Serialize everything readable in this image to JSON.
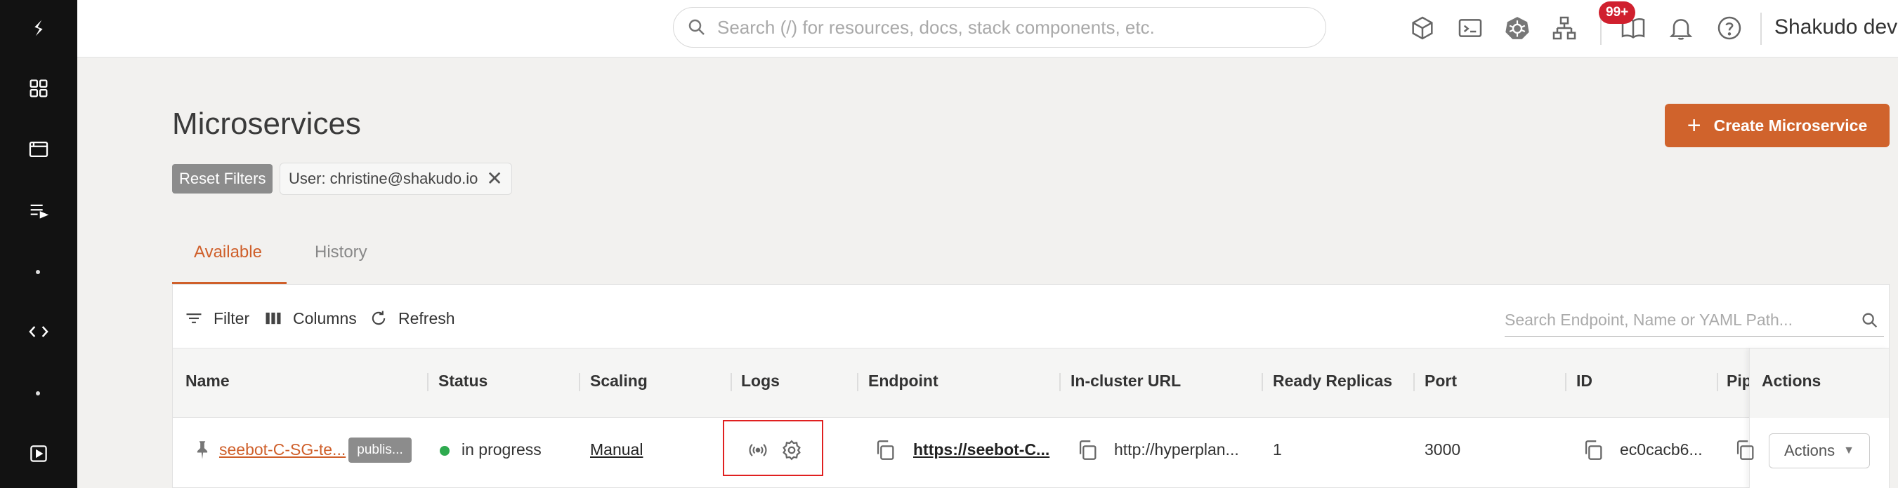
{
  "sidebar": {
    "items": [
      {
        "icon": "logo-icon"
      },
      {
        "icon": "grid-icon"
      },
      {
        "icon": "browser-window-icon"
      },
      {
        "icon": "playlist-icon"
      },
      {
        "icon": "dot-icon"
      },
      {
        "icon": "code-icon"
      },
      {
        "icon": "dot-icon"
      },
      {
        "icon": "play-box-icon"
      }
    ]
  },
  "header": {
    "search_placeholder": "Search (/) for resources, docs, stack components, etc.",
    "icons": [
      "cube-icon",
      "terminal-icon",
      "kubernetes-icon",
      "network-icon",
      "book-icon",
      "bell-icon",
      "help-icon"
    ],
    "notification_badge": "99+",
    "user_name": "Shakudo dev"
  },
  "page": {
    "title": "Microservices",
    "create_button": "Create Microservice",
    "create_button_icon": "+",
    "reset_filters": "Reset Filters",
    "filter_chip": "User: christine@shakudo.io",
    "filter_chip_close": "✕"
  },
  "tabs": [
    {
      "label": "Available",
      "active": true
    },
    {
      "label": "History",
      "active": false
    }
  ],
  "toolbar": {
    "filter": "Filter",
    "columns": "Columns",
    "refresh": "Refresh",
    "search_placeholder": "Search Endpoint, Name or YAML Path..."
  },
  "table": {
    "columns": [
      "Name",
      "Status",
      "Scaling",
      "Logs",
      "Endpoint",
      "In-cluster URL",
      "Ready Replicas",
      "Port",
      "ID",
      "Pip",
      "Actions"
    ],
    "rows": [
      {
        "name": "seebot-C-SG-te...",
        "tag": "publis...",
        "status": "in progress",
        "scaling": "Manual",
        "endpoint": "https://seebot-C...",
        "in_cluster_url": "http://hyperplan...",
        "ready_replicas": "1",
        "port": "3000",
        "id": "ec0cacb6...",
        "actions": "Actions"
      }
    ]
  },
  "colors": {
    "accent": "#cf5f2a",
    "sidebar_bg": "#121212",
    "status_in_progress": "#2eaa4f",
    "badge": "#d0202e",
    "highlight_box": "#e02020"
  }
}
